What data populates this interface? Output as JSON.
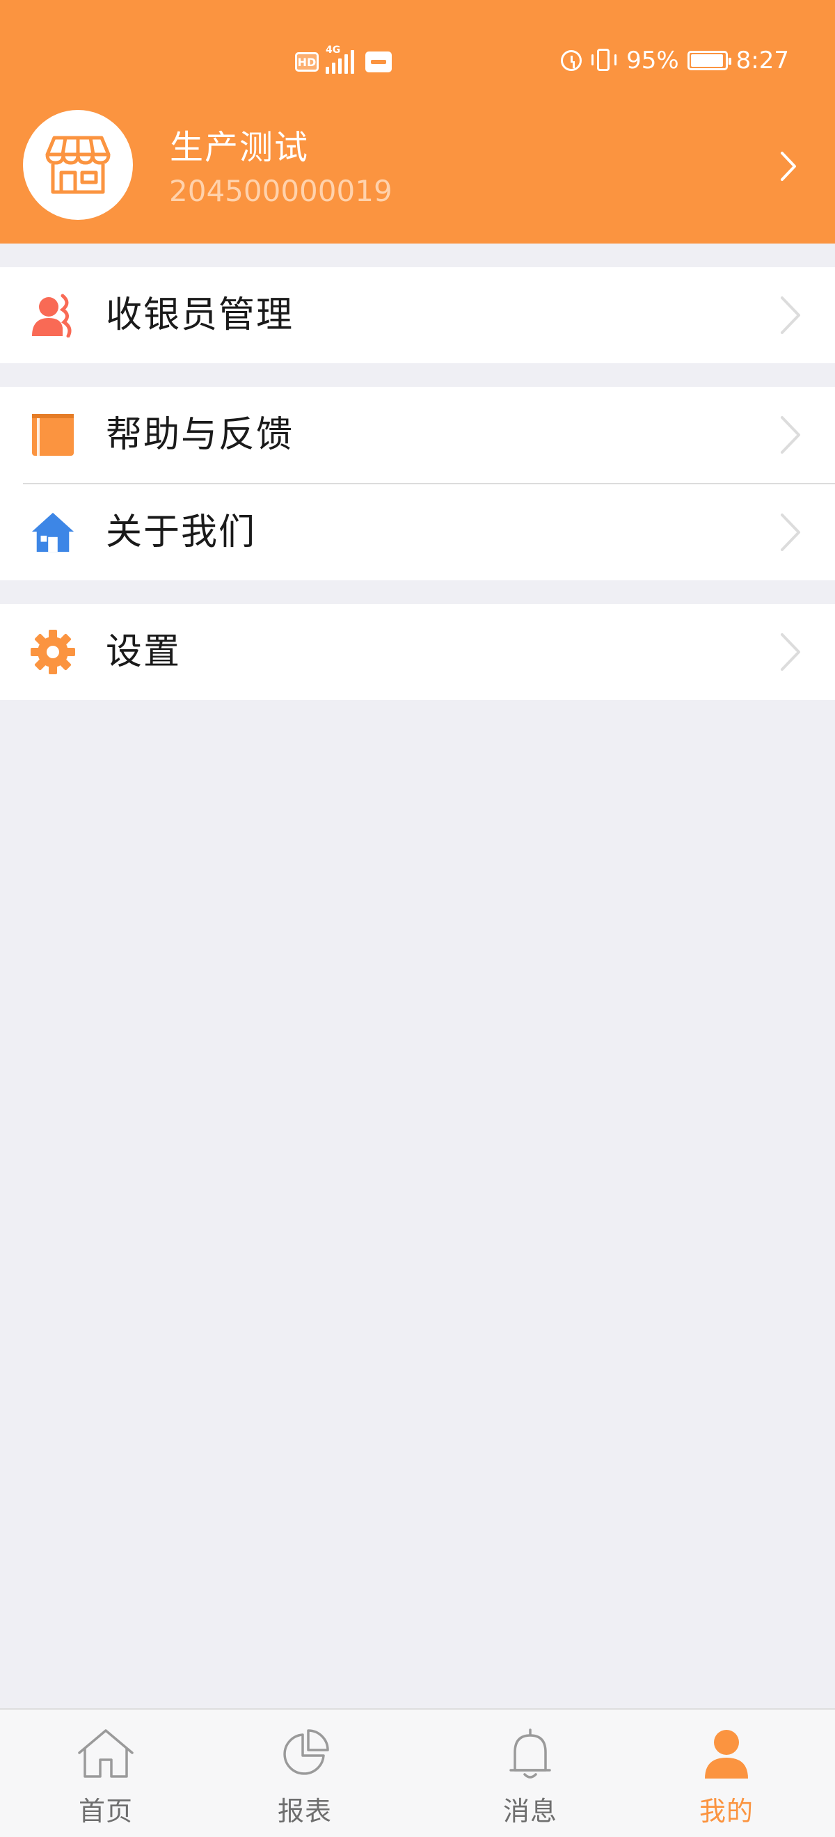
{
  "status_bar": {
    "hd": "HD",
    "network": "4G",
    "battery_percent": "95%",
    "battery_level": 0.95,
    "time": "8:27"
  },
  "profile": {
    "store_name": "生产测试",
    "store_id": "204500000019",
    "avatar_icon": "store-icon"
  },
  "menu": {
    "groups": [
      {
        "items": [
          {
            "label": "收银员管理",
            "icon": "cashier-user-icon",
            "icon_color": "#f96a55"
          }
        ]
      },
      {
        "items": [
          {
            "label": "帮助与反馈",
            "icon": "book-icon",
            "icon_color": "#fb9440"
          },
          {
            "label": "关于我们",
            "icon": "house-icon",
            "icon_color": "#3d86e6"
          }
        ]
      },
      {
        "items": [
          {
            "label": "设置",
            "icon": "gear-icon",
            "icon_color": "#fb9440"
          }
        ]
      }
    ]
  },
  "tabbar": {
    "tabs": [
      {
        "label": "首页",
        "icon": "home-icon",
        "active": false
      },
      {
        "label": "报表",
        "icon": "pie-chart-icon",
        "active": false
      },
      {
        "label": "消息",
        "icon": "bell-icon",
        "active": false
      },
      {
        "label": "我的",
        "icon": "user-icon",
        "active": true
      }
    ]
  },
  "colors": {
    "accent": "#fb9440",
    "background": "#efeff4",
    "tab_inactive": "#6e6e6e"
  }
}
